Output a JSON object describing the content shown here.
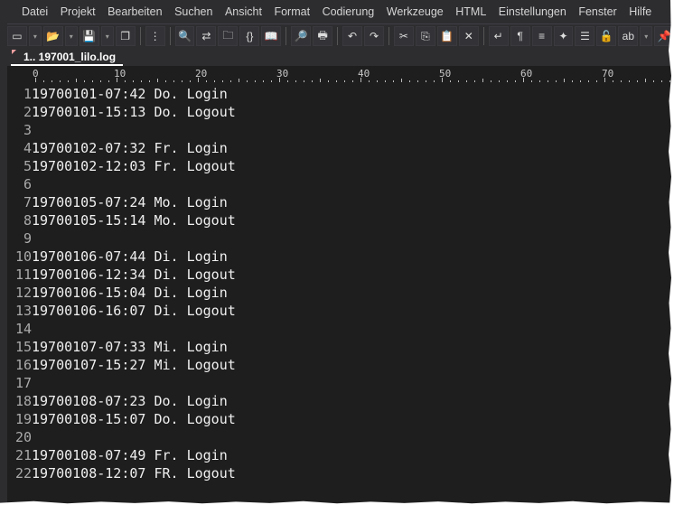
{
  "menu": [
    "Datei",
    "Projekt",
    "Bearbeiten",
    "Suchen",
    "Ansicht",
    "Format",
    "Codierung",
    "Werkzeuge",
    "HTML",
    "Einstellungen",
    "Fenster",
    "Hilfe"
  ],
  "toolbar": [
    {
      "icon": "new-file-icon",
      "glyph": "▭"
    },
    {
      "icon": "dropdown-icon",
      "glyph": "▾",
      "dd": true
    },
    {
      "icon": "open-folder-icon",
      "glyph": "📂"
    },
    {
      "icon": "dropdown-icon",
      "glyph": "▾",
      "dd": true
    },
    {
      "icon": "save-icon",
      "glyph": "💾"
    },
    {
      "icon": "dropdown-icon",
      "glyph": "▾",
      "dd": true
    },
    {
      "icon": "save-all-icon",
      "glyph": "❐"
    },
    {
      "sep": true
    },
    {
      "icon": "project-tree-icon",
      "glyph": "⋮"
    },
    {
      "sep": true
    },
    {
      "icon": "search-icon",
      "glyph": "🔍"
    },
    {
      "icon": "replace-icon",
      "glyph": "⇄"
    },
    {
      "icon": "find-in-files-icon",
      "glyph": "🗀"
    },
    {
      "icon": "code-brackets-icon",
      "glyph": "{}"
    },
    {
      "icon": "book-icon",
      "glyph": "📖"
    },
    {
      "sep": true
    },
    {
      "icon": "print-preview-icon",
      "glyph": "🔎"
    },
    {
      "icon": "print-icon",
      "glyph": "🖶"
    },
    {
      "sep": true
    },
    {
      "icon": "undo-icon",
      "glyph": "↶"
    },
    {
      "icon": "redo-icon",
      "glyph": "↷"
    },
    {
      "sep": true
    },
    {
      "icon": "cut-icon",
      "glyph": "✂"
    },
    {
      "icon": "copy-icon",
      "glyph": "⎘"
    },
    {
      "icon": "paste-icon",
      "glyph": "📋"
    },
    {
      "icon": "delete-icon",
      "glyph": "✕"
    },
    {
      "sep": true
    },
    {
      "icon": "word-wrap-icon",
      "glyph": "↵"
    },
    {
      "icon": "pilcrow-icon",
      "glyph": "¶"
    },
    {
      "icon": "syntax-highlight-icon",
      "glyph": "≡"
    },
    {
      "icon": "cpp-icon",
      "glyph": "✦"
    },
    {
      "icon": "outline-icon",
      "glyph": "☰"
    },
    {
      "icon": "unlock-icon",
      "glyph": "🔓"
    },
    {
      "icon": "spell-check-icon",
      "glyph": "ab"
    },
    {
      "icon": "dropdown-icon",
      "glyph": "▾",
      "dd": true
    },
    {
      "icon": "pin-icon",
      "glyph": "📌"
    }
  ],
  "tab": {
    "label": "1.. 197001_lilo.log"
  },
  "ruler": [
    "0",
    "10",
    "20",
    "30",
    "40",
    "50",
    "60",
    "70"
  ],
  "lines": [
    "19700101-07:42 Do. Login",
    "19700101-15:13 Do. Logout",
    "",
    "19700102-07:32 Fr. Login",
    "19700102-12:03 Fr. Logout",
    "",
    "19700105-07:24 Mo. Login",
    "19700105-15:14 Mo. Logout",
    "",
    "19700106-07:44 Di. Login",
    "19700106-12:34 Di. Logout",
    "19700106-15:04 Di. Login",
    "19700106-16:07 Di. Logout",
    "",
    "19700107-07:33 Mi. Login",
    "19700107-15:27 Mi. Logout",
    "",
    "19700108-07:23 Do. Login",
    "19700108-15:07 Do. Logout",
    "",
    "19700108-07:49 Fr. Login",
    "19700108-12:07 FR. Logout"
  ]
}
